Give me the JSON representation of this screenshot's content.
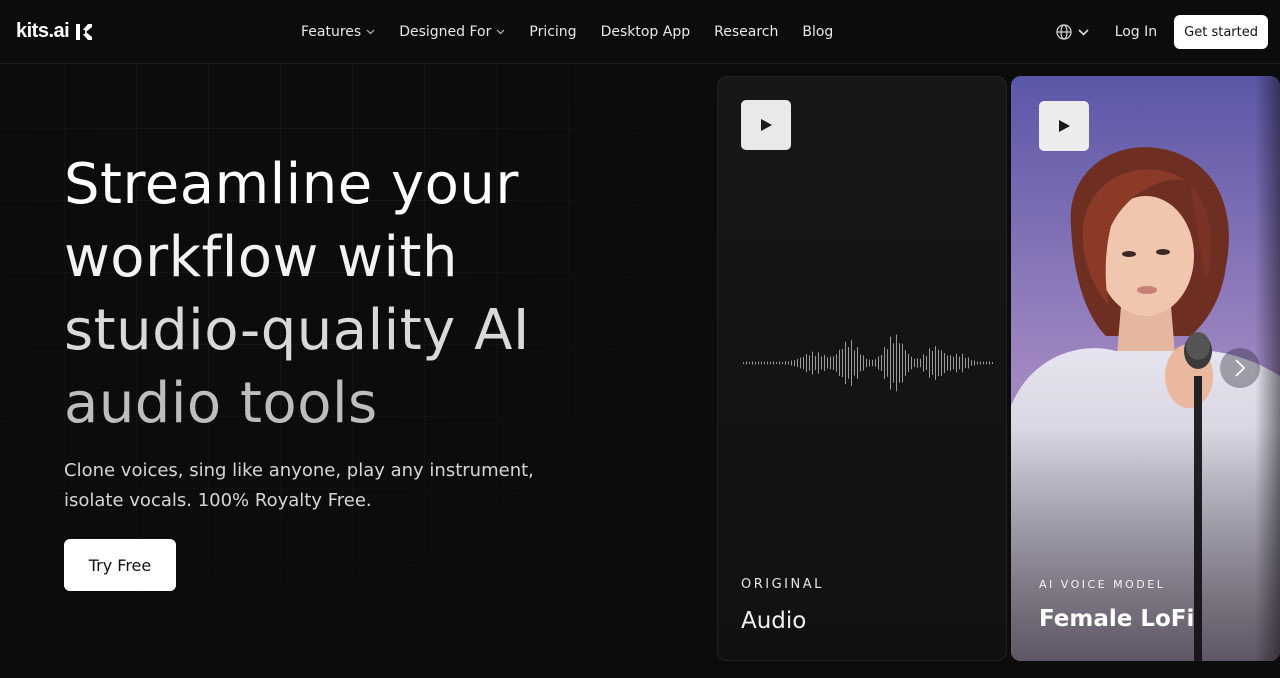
{
  "brand": {
    "name": "kits.ai"
  },
  "nav": {
    "items": [
      {
        "label": "Features",
        "has_dropdown": true
      },
      {
        "label": "Designed For",
        "has_dropdown": true
      },
      {
        "label": "Pricing",
        "has_dropdown": false
      },
      {
        "label": "Desktop App",
        "has_dropdown": false
      },
      {
        "label": "Research",
        "has_dropdown": false
      },
      {
        "label": "Blog",
        "has_dropdown": false
      }
    ],
    "language_icon": "globe-icon",
    "login_label": "Log In",
    "cta_label": "Get started"
  },
  "hero": {
    "title_lines": [
      "Streamline your",
      "workflow with",
      "studio-quality AI",
      "audio tools"
    ],
    "subtitle_lines": [
      "Clone voices, sing like anyone, play any instrument,",
      "isolate vocals. 100% Royalty Free."
    ],
    "cta_label": "Try Free"
  },
  "cards": [
    {
      "label": "ORIGINAL",
      "name": "Audio",
      "icon": "play-icon"
    },
    {
      "label": "AI VOICE MODEL",
      "name": "Female LoFi",
      "icon": "play-icon"
    }
  ],
  "carousel": {
    "next_icon": "chevron-right-icon"
  },
  "colors": {
    "background": "#0c0c0c",
    "button_bg": "#ffffff",
    "button_text": "#111111"
  }
}
